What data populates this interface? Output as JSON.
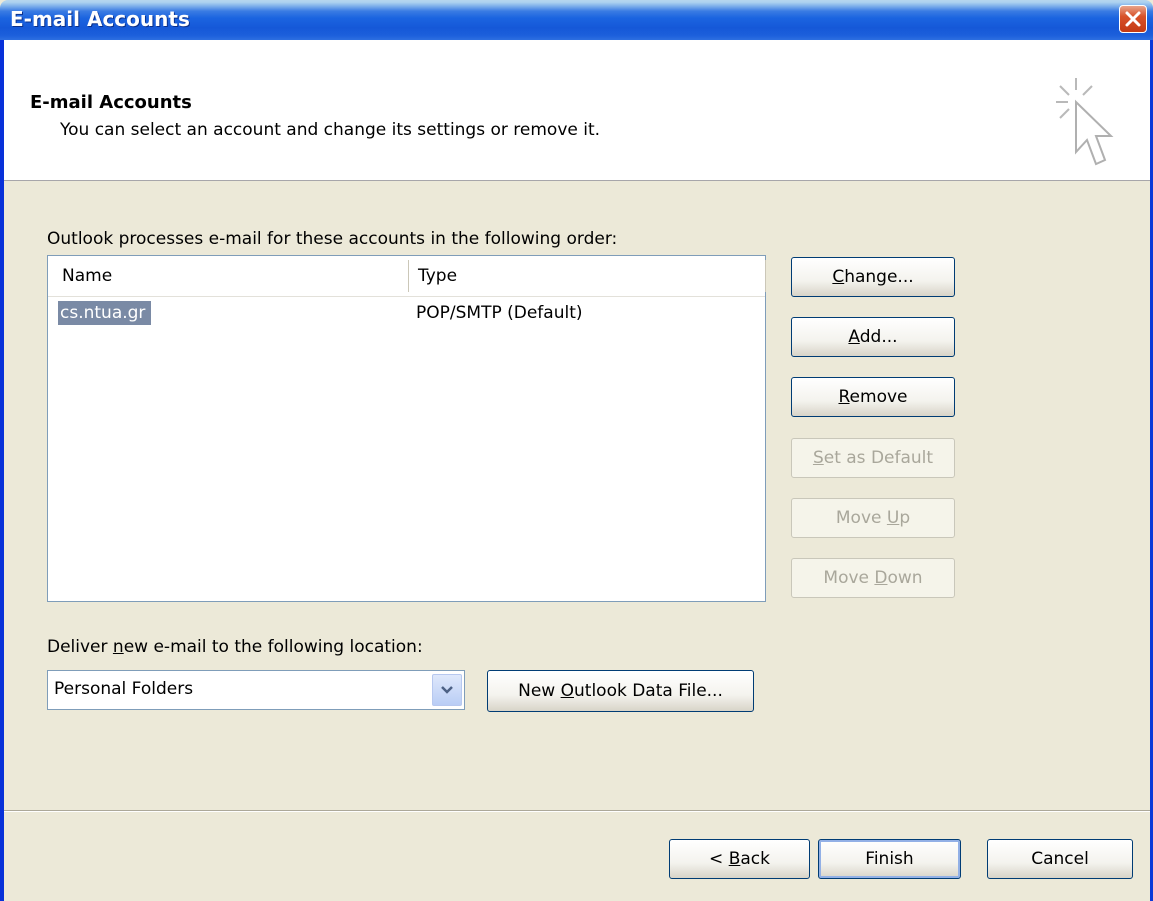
{
  "window": {
    "title": "E-mail Accounts"
  },
  "header": {
    "title": "E-mail Accounts",
    "subtitle": "You can select an account and change its settings or remove it.",
    "icon": "wizard-cursor-icon"
  },
  "accounts": {
    "intro": "Outlook processes e-mail for these accounts in the following order:",
    "columns": {
      "name": "Name",
      "type": "Type"
    },
    "rows": [
      {
        "name": "cs.ntua.gr",
        "type": "POP/SMTP (Default)",
        "selected": true
      }
    ]
  },
  "side_buttons": {
    "change": {
      "pre": "",
      "key": "C",
      "post": "hange..."
    },
    "add": {
      "pre": "",
      "key": "A",
      "post": "dd..."
    },
    "remove": {
      "pre": "",
      "key": "R",
      "post": "emove"
    },
    "set_default": {
      "pre": "",
      "key": "S",
      "post": "et as Default"
    },
    "move_up": {
      "pre": "Move ",
      "key": "U",
      "post": "p"
    },
    "move_down": {
      "pre": "Move ",
      "key": "D",
      "post": "own"
    }
  },
  "delivery": {
    "label_pre": "Deliver ",
    "label_key": "n",
    "label_post": "ew e-mail to the following location:",
    "selected": "Personal Folders",
    "new_file": {
      "pre": "New ",
      "key": "O",
      "post": "utlook Data File..."
    }
  },
  "footer": {
    "back": {
      "pre": "< ",
      "key": "B",
      "post": "ack"
    },
    "finish": "Finish",
    "cancel": "Cancel"
  }
}
